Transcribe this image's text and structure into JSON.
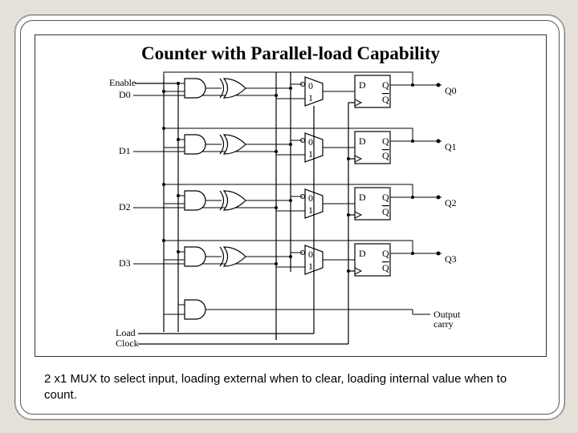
{
  "title": "Counter with Parallel-load Capability",
  "caption": "2 x1 MUX to select input, loading external when to clear, loading internal value when to count.",
  "labels": {
    "enable": "Enable",
    "d0": "D0",
    "d1": "D1",
    "d2": "D2",
    "d3": "D3",
    "load": "Load",
    "clock": "Clock",
    "q0": "Q0",
    "q1": "Q1",
    "q2": "Q2",
    "q3": "Q3",
    "output": "Output",
    "carry": "carry",
    "ff_d": "D",
    "ff_q": "Q",
    "ff_qb": "Q"
  }
}
